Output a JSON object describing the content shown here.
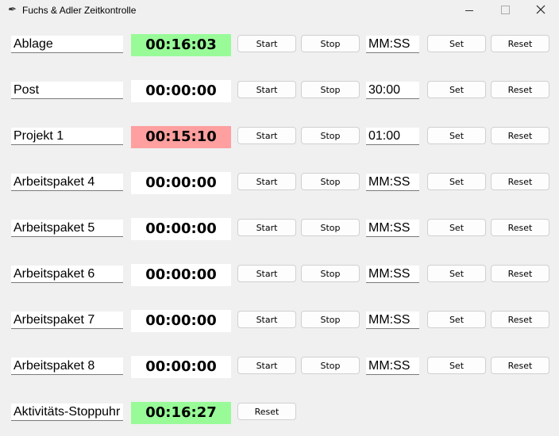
{
  "window": {
    "title": "Fuchs & Adler Zeitkontrolle",
    "app_icon": "feather-icon"
  },
  "labels": {
    "start": "Start",
    "stop": "Stop",
    "set": "Set",
    "reset": "Reset"
  },
  "rows": [
    {
      "name": "Ablage",
      "time": "00:16:03",
      "duration": "MM:SS",
      "state_color": "#98fb98"
    },
    {
      "name": "Post",
      "time": "00:00:00",
      "duration": "30:00",
      "state_color": "#ffffff"
    },
    {
      "name": "Projekt 1",
      "time": "00:15:10",
      "duration": "01:00",
      "state_color": "#ff9f9f"
    },
    {
      "name": "Arbeitspaket 4",
      "time": "00:00:00",
      "duration": "MM:SS",
      "state_color": "#ffffff"
    },
    {
      "name": "Arbeitspaket 5",
      "time": "00:00:00",
      "duration": "MM:SS",
      "state_color": "#ffffff"
    },
    {
      "name": "Arbeitspaket 6",
      "time": "00:00:00",
      "duration": "MM:SS",
      "state_color": "#ffffff"
    },
    {
      "name": "Arbeitspaket 7",
      "time": "00:00:00",
      "duration": "MM:SS",
      "state_color": "#ffffff"
    },
    {
      "name": "Arbeitspaket 8",
      "time": "00:00:00",
      "duration": "MM:SS",
      "state_color": "#ffffff"
    }
  ],
  "stopwatch": {
    "name": "Aktivitäts-Stoppuhr",
    "time": "00:16:27",
    "state_color": "#98fb98"
  }
}
